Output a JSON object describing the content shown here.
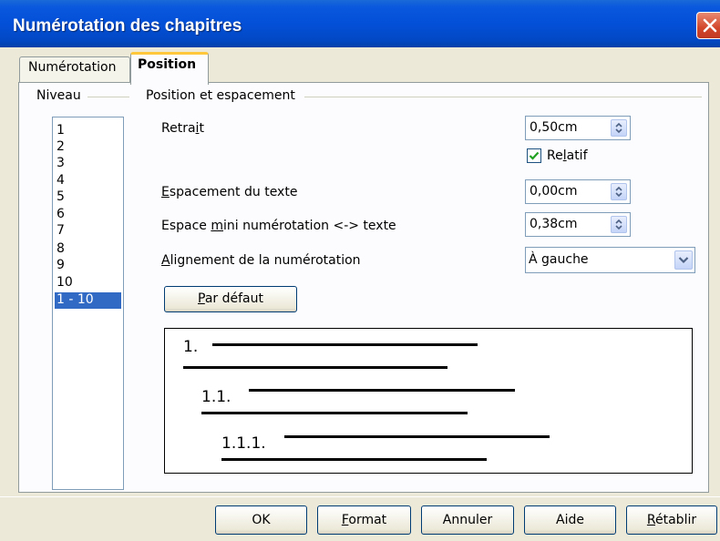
{
  "window": {
    "title": "Numérotation des chapitres"
  },
  "tabs": [
    {
      "label": "Numérotation",
      "active": false
    },
    {
      "label": "Position",
      "active": true
    }
  ],
  "levels": {
    "group_label": "Niveau",
    "items": [
      "1",
      "2",
      "3",
      "4",
      "5",
      "6",
      "7",
      "8",
      "9",
      "10",
      "1 - 10"
    ],
    "selected": "1 - 10"
  },
  "position": {
    "group_label": "Position et espacement",
    "indent": {
      "label": "Retrait",
      "value": "0,50cm"
    },
    "relative": {
      "label": "Relatif",
      "checked": true
    },
    "text_spacing": {
      "label": "Espacement du texte",
      "value": "0,00cm"
    },
    "min_spacing": {
      "label": "Espace mini numérotation <-> texte",
      "value": "0,38cm"
    },
    "alignment": {
      "label": "Alignement de la numérotation",
      "value": "À gauche"
    },
    "default_button": "Par défaut"
  },
  "preview": {
    "numbers": [
      "1.",
      "1.1.",
      "1.1.1."
    ]
  },
  "buttons": {
    "ok": "OK",
    "format": "Format",
    "cancel": "Annuler",
    "help": "Aide",
    "reset": "Rétablir"
  },
  "colors": {
    "titlebar": "#0350d8",
    "selection": "#316ac5",
    "active_tab_accent": "#ffc83c",
    "close_button": "#d2472b"
  },
  "icons": {
    "close": "close-icon",
    "spin": "spin-arrows-icon",
    "dropdown": "chevron-down-icon",
    "checkmark": "checkmark-icon"
  }
}
